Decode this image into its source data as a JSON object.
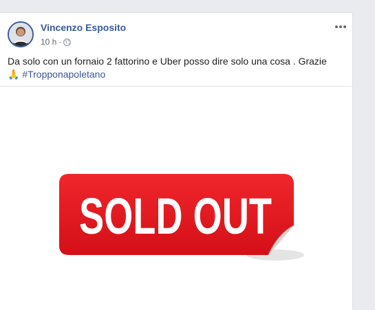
{
  "post": {
    "author_name": "Vincenzo Esposito",
    "time": "10 h",
    "separator": "·",
    "privacy_icon": "globe-icon",
    "more_icon": "more-options-icon",
    "text_main": "Da solo con un fornaio 2 fattorino e Uber posso dire solo una cosa . Grazie",
    "emoji": "🙏",
    "hashtag": "#Tropponapoletano",
    "image": {
      "text": "SOLD OUT",
      "sticker_color": "#e3131b",
      "text_color": "#ffffff"
    }
  },
  "colors": {
    "author": "#385898",
    "meta": "#616770",
    "background": "#e9ebee"
  }
}
